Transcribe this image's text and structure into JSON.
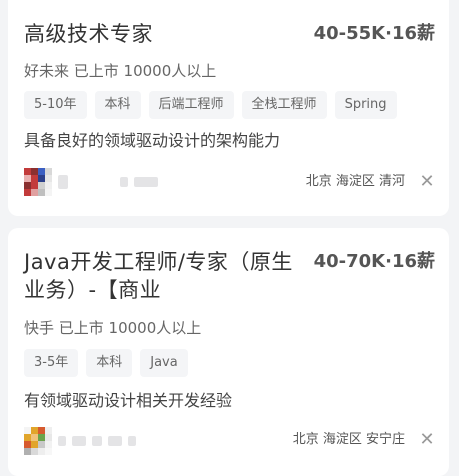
{
  "jobs": [
    {
      "title": "高级技术专家",
      "salary": "40-55K·16薪",
      "company": "好未来 已上市 10000人以上",
      "tags": [
        "5-10年",
        "本科",
        "后端工程师",
        "全栈工程师",
        "Spring"
      ],
      "description": "具备良好的领域驱动设计的架构能力",
      "location": "北京 海淀区 清河",
      "close_icon": "close-icon",
      "avatar_colors": [
        "#c23b3b",
        "#3b5fc2",
        "#e0e0e0",
        "#c23b3b"
      ]
    },
    {
      "title_line1": "Java开发工程师/专家（原生",
      "title_line2": "业务）-【商业",
      "salary": "40-70K·16薪",
      "company": "快手 已上市 10000人以上",
      "tags": [
        "3-5年",
        "本科",
        "Java"
      ],
      "description": "有领域驱动设计相关开发经验",
      "location": "北京 海淀区 安宁庄",
      "close_icon": "close-icon",
      "avatar_colors": [
        "#e1a52b",
        "#d65a2e",
        "#6ba34a",
        "#c9c9c9"
      ]
    }
  ]
}
